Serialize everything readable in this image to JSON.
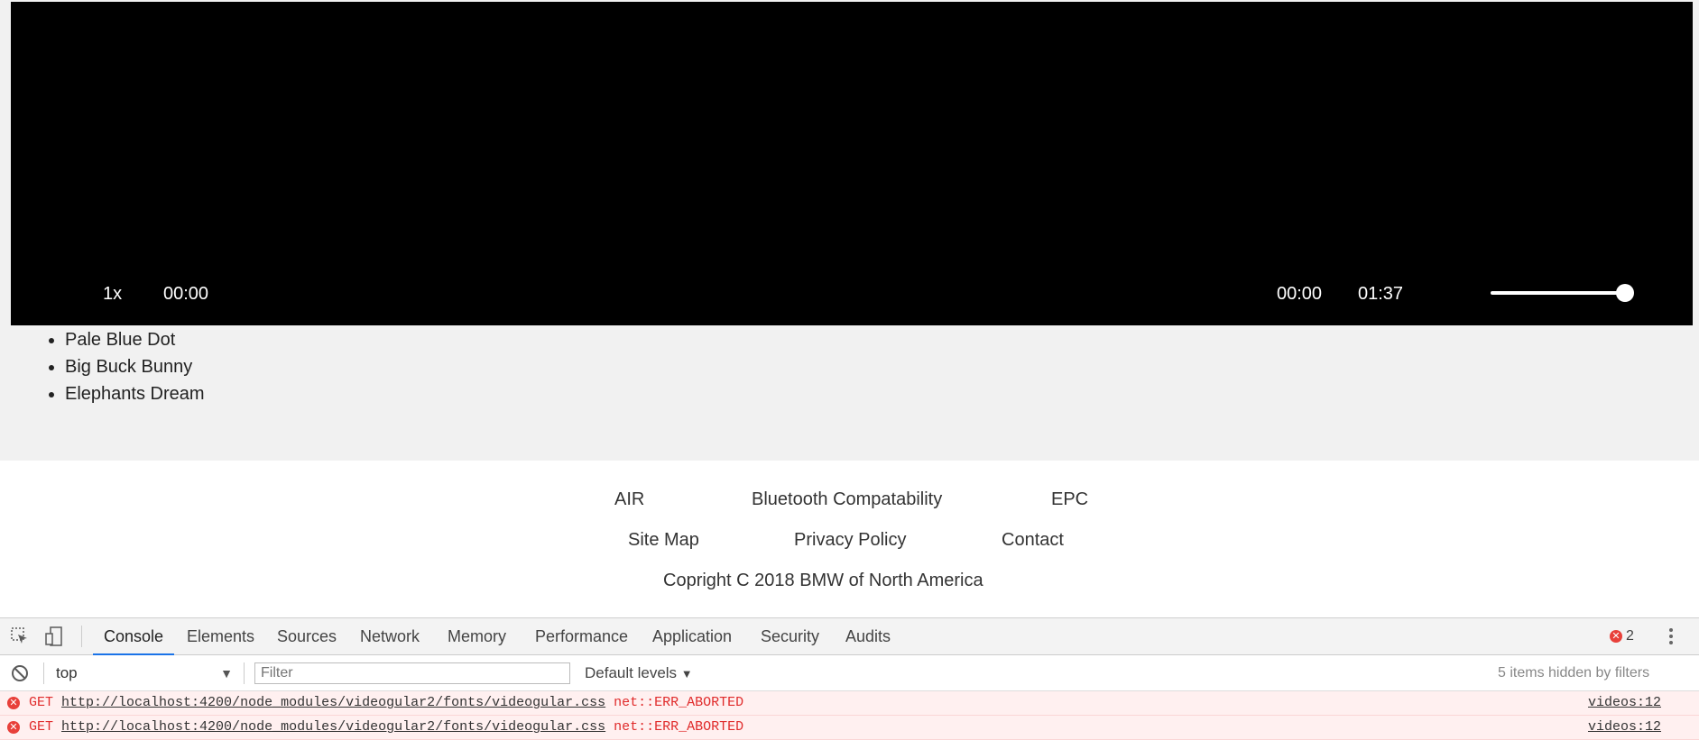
{
  "video": {
    "speed": "1x",
    "current_left": "00:00",
    "current_right": "00:00",
    "duration": "01:37",
    "volume_level": 1.0
  },
  "playlist": [
    "Pale Blue Dot",
    "Big Buck Bunny",
    "Elephants Dream"
  ],
  "footer": {
    "row1": [
      "AIR",
      "Bluetooth Compatability",
      "EPC"
    ],
    "row2": [
      "Site Map",
      "Privacy Policy",
      "Contact"
    ],
    "copyright": "Copright C 2018 BMW of North America"
  },
  "devtools": {
    "tabs": [
      "Console",
      "Elements",
      "Sources",
      "Network",
      "Memory",
      "Performance",
      "Application",
      "Security",
      "Audits"
    ],
    "active_tab": "Console",
    "error_count": "2",
    "context": "top",
    "filter_placeholder": "Filter",
    "levels": "Default levels",
    "hidden_info": "5 items hidden by filters",
    "logs": [
      {
        "method": "GET",
        "url": "http://localhost:4200/node_modules/videogular2/fonts/videogular.css",
        "error": "net::ERR_ABORTED",
        "source": "videos:12"
      },
      {
        "method": "GET",
        "url": "http://localhost:4200/node_modules/videogular2/fonts/videogular.css",
        "error": "net::ERR_ABORTED",
        "source": "videos:12"
      }
    ],
    "colors": {
      "accent": "#1a73e8",
      "error": "#e8403a"
    }
  }
}
